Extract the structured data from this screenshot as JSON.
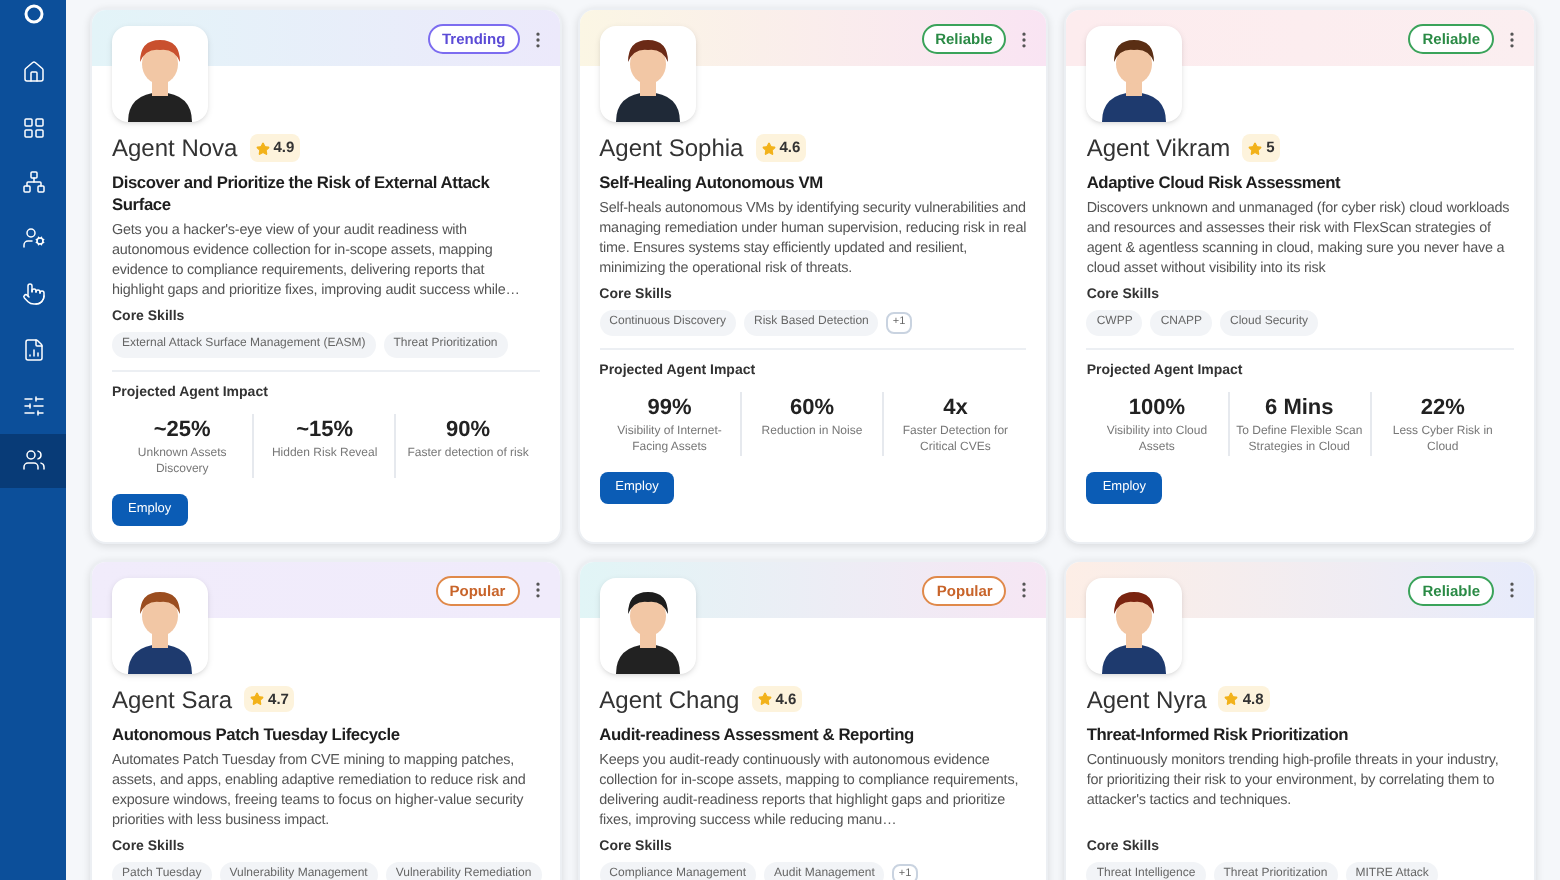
{
  "sidebar": {
    "items": [
      {
        "kind": "home",
        "selected": false
      },
      {
        "kind": "grid",
        "selected": false
      },
      {
        "kind": "network",
        "selected": false
      },
      {
        "kind": "user-gear",
        "selected": false
      },
      {
        "kind": "pointer",
        "selected": false
      },
      {
        "kind": "report",
        "selected": false
      },
      {
        "kind": "sliders",
        "selected": false
      },
      {
        "kind": "users",
        "selected": true
      }
    ]
  },
  "agents": [
    {
      "name": "Agent Nova",
      "rating": "4.9",
      "badge": {
        "label": "Trending",
        "kind": "trending"
      },
      "title": "Discover and Prioritize the Risk of External Attack Surface",
      "description": "Gets you a hacker's-eye view of your audit readiness with autonomous evidence collection for in-scope assets, mapping evidence to compliance requirements, delivering reports that highlight gaps and prioritize fixes, improving audit success while…",
      "skills_label": "Core Skills",
      "skills": [
        "External Attack Surface Management (EASM)",
        "Threat Prioritization"
      ],
      "impact": {
        "label": "Projected Agent Impact",
        "metrics": [
          {
            "value": "~25%",
            "caption": "Unknown Assets Discovery"
          },
          {
            "value": "~15%",
            "caption": "Hidden Risk Reveal"
          },
          {
            "value": "90%",
            "caption": "Faster detection of risk"
          }
        ]
      },
      "button": "Employ"
    },
    {
      "name": "Agent Sophia",
      "rating": "4.6",
      "badge": {
        "label": "Reliable",
        "kind": "reliable"
      },
      "title": "Self-Healing Autonomous VM",
      "description": "Self-heals autonomous VMs by identifying security vulnerabilities and managing remediation under human supervision, reducing risk in real time. Ensures systems stay efficiently updated and resilient, minimizing the operational risk of threats.",
      "skills_label": "Core Skills",
      "skills": [
        "Continuous Discovery",
        "Risk Based Detection"
      ],
      "more_skills": "+1",
      "impact": {
        "label": "Projected Agent Impact",
        "metrics": [
          {
            "value": "99%",
            "caption": "Visibility of Internet-Facing Assets"
          },
          {
            "value": "60%",
            "caption": "Reduction in Noise"
          },
          {
            "value": "4x",
            "caption": "Faster Detection for Critical CVEs"
          }
        ]
      },
      "button": "Employ"
    },
    {
      "name": "Agent Vikram",
      "rating": "5",
      "badge": {
        "label": "Reliable",
        "kind": "reliable"
      },
      "title": "Adaptive Cloud Risk Assessment",
      "description": "Discovers unknown and unmanaged (for cyber risk) cloud workloads and resources and assesses their risk with FlexScan strategies of agent & agentless scanning in cloud, making sure you never have a cloud asset without visibility into its risk",
      "skills_label": "Core Skills",
      "skills": [
        "CWPP",
        "CNAPP",
        "Cloud Security"
      ],
      "impact": {
        "label": "Projected Agent Impact",
        "metrics": [
          {
            "value": "100%",
            "caption": "Visibility into Cloud Assets"
          },
          {
            "value": "6 Mins",
            "caption": "To Define Flexible Scan Strategies in Cloud"
          },
          {
            "value": "22%",
            "caption": "Less Cyber Risk in Cloud"
          }
        ]
      },
      "button": "Employ"
    },
    {
      "name": "Agent Sara",
      "rating": "4.7",
      "badge": {
        "label": "Popular",
        "kind": "popular"
      },
      "title": "Autonomous Patch Tuesday Lifecycle",
      "description": "Automates Patch Tuesday from CVE mining to mapping patches, assets, and apps, enabling adaptive remediation to reduce risk and exposure windows, freeing teams to focus on higher-value security priorities with less business impact.",
      "skills_label": "Core Skills",
      "skills": [
        "Patch Tuesday",
        "Vulnerability Management",
        "Vulnerability Remediation"
      ]
    },
    {
      "name": "Agent Chang",
      "rating": "4.6",
      "badge": {
        "label": "Popular",
        "kind": "popular"
      },
      "title": "Audit-readiness Assessment & Reporting",
      "description": "Keeps you audit-ready continuously with autonomous evidence collection for in-scope assets, mapping to compliance requirements, delivering audit-readiness reports that highlight gaps and prioritize fixes, improving success while reducing manu…",
      "skills_label": "Core Skills",
      "skills": [
        "Compliance Management",
        "Audit Management"
      ],
      "more_skills": "+1"
    },
    {
      "name": "Agent Nyra",
      "rating": "4.8",
      "badge": {
        "label": "Reliable",
        "kind": "reliable"
      },
      "title": "Threat-Informed Risk Prioritization",
      "description": "Continuously monitors trending high-profile threats in your industry, for prioritizing their risk to your environment, by correlating them to attacker's tactics and techniques.",
      "skills_label": "Core Skills",
      "skills": [
        "Threat Intelligence",
        "Threat Prioritization",
        "MITRE Attack"
      ]
    }
  ]
}
